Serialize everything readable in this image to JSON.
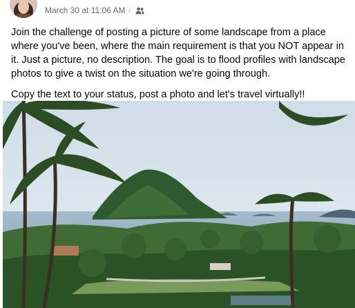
{
  "post": {
    "timestamp": "March 30 at 11:06 AM",
    "separator": "·",
    "audience_icon": "friends-icon",
    "paragraphs": [
      "Join the challenge of posting a picture of some landscape from a place where you've been, where the main requirement is that you NOT appear in it. Just a picture, no description. The goal is to flood profiles with landscape photos to give a twist on the situation we're going through.",
      "Copy the text to your status, post a photo and let's travel virtually!!"
    ]
  },
  "colors": {
    "meta_text": "#65676b",
    "body_text": "#050505",
    "sky": "#dfe8ef",
    "sea": "#8fa9bd",
    "foliage": "#2e5a2c"
  }
}
